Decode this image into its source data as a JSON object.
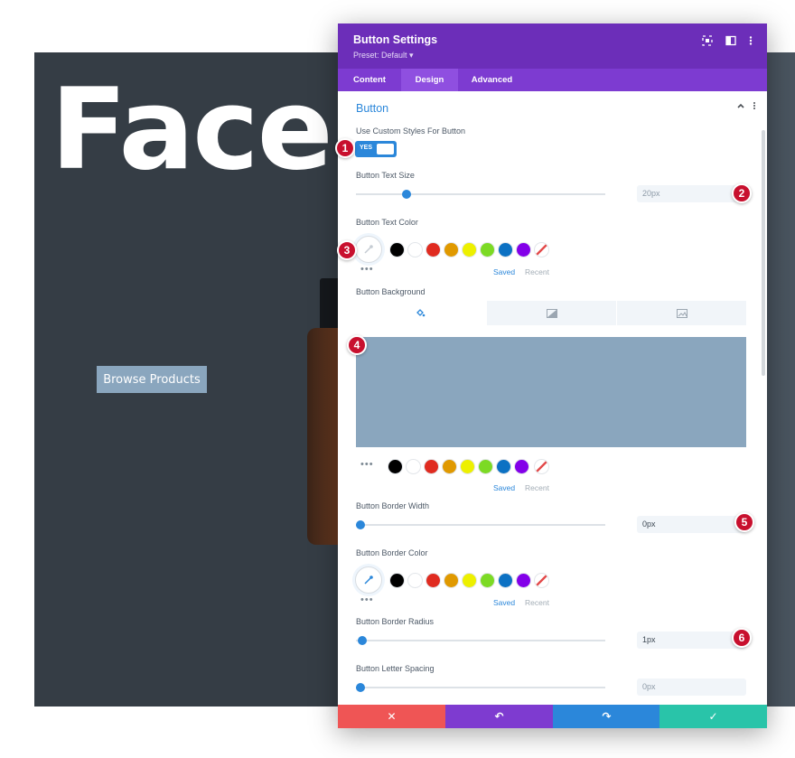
{
  "page": {
    "hero_title": "Face",
    "hero_button": "Browse Products"
  },
  "modal": {
    "title": "Button Settings",
    "preset": "Preset: Default",
    "tabs": [
      "Content",
      "Design",
      "Advanced"
    ],
    "active_tab": "Design",
    "header_icons": [
      "focus-icon",
      "split-view-icon",
      "more-vertical-icon"
    ],
    "section_title": "Button",
    "fields": {
      "custom_styles": {
        "label": "Use Custom Styles For Button",
        "value": "YES"
      },
      "text_size": {
        "label": "Button Text Size",
        "value": "20px",
        "slider_fraction": 0.2
      },
      "text_color": {
        "label": "Button Text Color",
        "saved": "Saved",
        "recent": "Recent"
      },
      "background": {
        "label": "Button Background",
        "color": "#8aa6be",
        "saved": "Saved",
        "recent": "Recent"
      },
      "border_width": {
        "label": "Button Border Width",
        "value": "0px",
        "slider_fraction": 0.0
      },
      "border_color": {
        "label": "Button Border Color",
        "saved": "Saved",
        "recent": "Recent"
      },
      "border_radius": {
        "label": "Button Border Radius",
        "value": "1px",
        "slider_fraction": 0.02
      },
      "letter_spacing": {
        "label": "Button Letter Spacing",
        "value": "0px",
        "slider_fraction": 0.0
      }
    },
    "swatches": [
      "#000000",
      "#ffffff",
      "#e02b20",
      "#e09900",
      "#edf000",
      "#7cda24",
      "#0c71c3",
      "#8300e9"
    ],
    "footer": {
      "cancel": "✕",
      "undo": "↶",
      "redo": "↷",
      "save": "✓"
    }
  },
  "markers": [
    "1",
    "2",
    "3",
    "4",
    "5",
    "6"
  ],
  "colors": {
    "purple_header": "#6c2eb9",
    "accent_blue": "#2b87da",
    "cancel_red": "#ef5555",
    "undo_purple": "#7e3bd0",
    "redo_blue": "#2b87da",
    "save_green": "#29c4a9"
  }
}
